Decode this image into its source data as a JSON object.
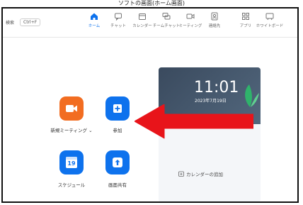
{
  "screenshot_title": "ソフトの画面(ホーム画面)",
  "topbar": {
    "search_label": "検索",
    "search_shortcut": "Ctrl+F",
    "nav": [
      {
        "label": "ホーム",
        "icon": "home-icon",
        "active": true
      },
      {
        "label": "チャット",
        "icon": "chat-icon"
      },
      {
        "label": "カレンダー",
        "icon": "calendar-icon"
      },
      {
        "label": "チームチャット",
        "icon": "team-chat-icon"
      },
      {
        "label": "ミーティング",
        "icon": "meeting-icon"
      },
      {
        "label": "連絡先",
        "icon": "contacts-icon"
      },
      {
        "label": "アプリ",
        "icon": "apps-icon"
      },
      {
        "label": "ホワイトボード",
        "icon": "whiteboard-icon"
      }
    ]
  },
  "actions": {
    "new_meeting": "新規ミーティング",
    "new_meeting_chevron": "⌄",
    "join": "参加",
    "schedule": "スケジュール",
    "schedule_date": "19",
    "share_screen": "画面共有"
  },
  "calendar": {
    "time": "11:01",
    "date": "2023年7月19日",
    "add_calendar": "カレンダーの追加"
  },
  "colors": {
    "accent_blue": "#0e72ed",
    "accent_orange": "#f26d21",
    "arrow_red": "#e8141a"
  }
}
